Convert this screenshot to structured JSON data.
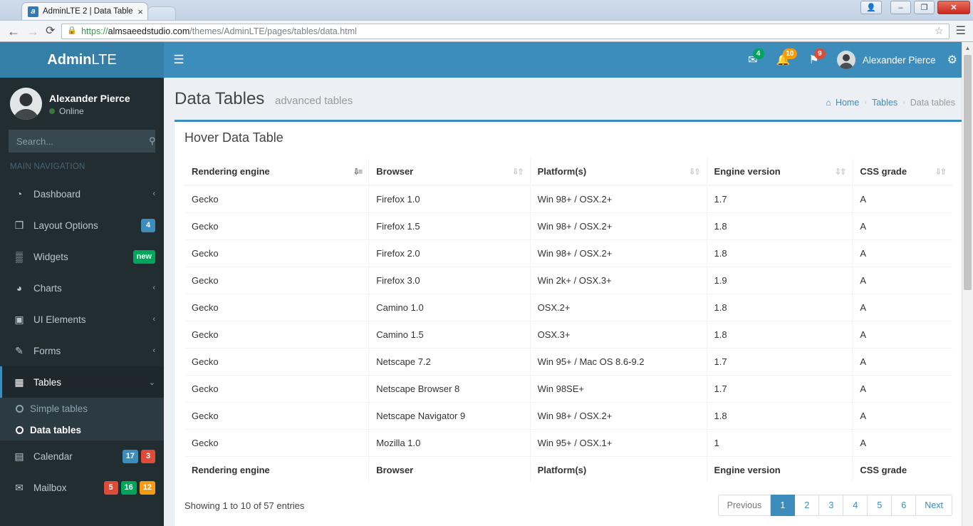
{
  "browser": {
    "tab": {
      "title": "AdminLTE 2 | Data Table",
      "favicon_letter": "a",
      "close_label": "×"
    },
    "nav": {
      "back": "←",
      "forward": "→",
      "reload": "⟳",
      "star": "☆",
      "menu": "☰"
    },
    "window_controls": {
      "user": "👤",
      "minimize": "–",
      "maximize": "❐",
      "close": "✕"
    },
    "url": {
      "lock": "🔒",
      "scheme": "https://",
      "host": "almsaeedstudio.com",
      "path": "/themes/AdminLTE/pages/tables/data.html"
    }
  },
  "header": {
    "logo_bold": "Admin",
    "logo_light": "LTE",
    "toggle_icon": "☰",
    "notifications": [
      {
        "name": "messages",
        "icon": "✉",
        "count": "4",
        "color": "#00a65a"
      },
      {
        "name": "notifications",
        "icon": "🔔",
        "count": "10",
        "color": "#f39c12"
      },
      {
        "name": "tasks",
        "icon": "⚑",
        "count": "9",
        "color": "#dd4b39"
      }
    ],
    "user_name": "Alexander Pierce",
    "settings_icon": "⚙"
  },
  "sidebar": {
    "user": {
      "name": "Alexander Pierce",
      "status": "Online"
    },
    "search": {
      "placeholder": "Search...",
      "value": "",
      "icon": "⚲"
    },
    "nav_header": "MAIN NAVIGATION",
    "items": [
      {
        "label": "Dashboard",
        "icon": "◔",
        "arrow": "‹",
        "badges": []
      },
      {
        "label": "Layout Options",
        "icon": "❐",
        "arrow": "",
        "badges": [
          {
            "text": "4",
            "color": "#3c8dbc"
          }
        ]
      },
      {
        "label": "Widgets",
        "icon": "▒",
        "arrow": "",
        "badges": [
          {
            "text": "new",
            "color": "#00a65a"
          }
        ]
      },
      {
        "label": "Charts",
        "icon": "◕",
        "arrow": "‹",
        "badges": []
      },
      {
        "label": "UI Elements",
        "icon": "▣",
        "arrow": "‹",
        "badges": []
      },
      {
        "label": "Forms",
        "icon": "✎",
        "arrow": "‹",
        "badges": []
      },
      {
        "label": "Tables",
        "icon": "▦",
        "arrow": "⌄",
        "badges": [],
        "open": true
      },
      {
        "label": "Calendar",
        "icon": "▤",
        "arrow": "",
        "badges": [
          {
            "text": "17",
            "color": "#3c8dbc"
          },
          {
            "text": "3",
            "color": "#dd4b39"
          }
        ]
      },
      {
        "label": "Mailbox",
        "icon": "✉",
        "arrow": "",
        "badges": [
          {
            "text": "5",
            "color": "#dd4b39"
          },
          {
            "text": "16",
            "color": "#00a65a"
          },
          {
            "text": "12",
            "color": "#f39c12"
          }
        ]
      }
    ],
    "tables_subitems": [
      {
        "label": "Simple tables",
        "active": false
      },
      {
        "label": "Data tables",
        "active": true
      }
    ]
  },
  "page": {
    "title": "Data Tables",
    "subtitle": "advanced tables",
    "breadcrumb": {
      "home_icon": "⌂",
      "home": "Home",
      "sep": "›",
      "middle": "Tables",
      "current": "Data tables"
    }
  },
  "box": {
    "title": "Hover Data Table"
  },
  "table": {
    "columns": [
      {
        "label": "Rendering engine",
        "sort": "active"
      },
      {
        "label": "Browser",
        "sort": "none"
      },
      {
        "label": "Platform(s)",
        "sort": "none"
      },
      {
        "label": "Engine version",
        "sort": "none"
      },
      {
        "label": "CSS grade",
        "sort": "none"
      }
    ],
    "rows": [
      [
        "Gecko",
        "Firefox 1.0",
        "Win 98+ / OSX.2+",
        "1.7",
        "A"
      ],
      [
        "Gecko",
        "Firefox 1.5",
        "Win 98+ / OSX.2+",
        "1.8",
        "A"
      ],
      [
        "Gecko",
        "Firefox 2.0",
        "Win 98+ / OSX.2+",
        "1.8",
        "A"
      ],
      [
        "Gecko",
        "Firefox 3.0",
        "Win 2k+ / OSX.3+",
        "1.9",
        "A"
      ],
      [
        "Gecko",
        "Camino 1.0",
        "OSX.2+",
        "1.8",
        "A"
      ],
      [
        "Gecko",
        "Camino 1.5",
        "OSX.3+",
        "1.8",
        "A"
      ],
      [
        "Gecko",
        "Netscape 7.2",
        "Win 95+ / Mac OS 8.6-9.2",
        "1.7",
        "A"
      ],
      [
        "Gecko",
        "Netscape Browser 8",
        "Win 98SE+",
        "1.7",
        "A"
      ],
      [
        "Gecko",
        "Netscape Navigator 9",
        "Win 98+ / OSX.2+",
        "1.8",
        "A"
      ],
      [
        "Gecko",
        "Mozilla 1.0",
        "Win 95+ / OSX.1+",
        "1",
        "A"
      ]
    ],
    "footer_columns": [
      "Rendering engine",
      "Browser",
      "Platform(s)",
      "Engine version",
      "CSS grade"
    ],
    "info": "Showing 1 to 10 of 57 entries",
    "pagination": [
      {
        "label": "Previous",
        "active": false
      },
      {
        "label": "1",
        "active": true
      },
      {
        "label": "2",
        "active": false
      },
      {
        "label": "3",
        "active": false
      },
      {
        "label": "4",
        "active": false
      },
      {
        "label": "5",
        "active": false
      },
      {
        "label": "6",
        "active": false
      },
      {
        "label": "Next",
        "active": false
      }
    ]
  }
}
